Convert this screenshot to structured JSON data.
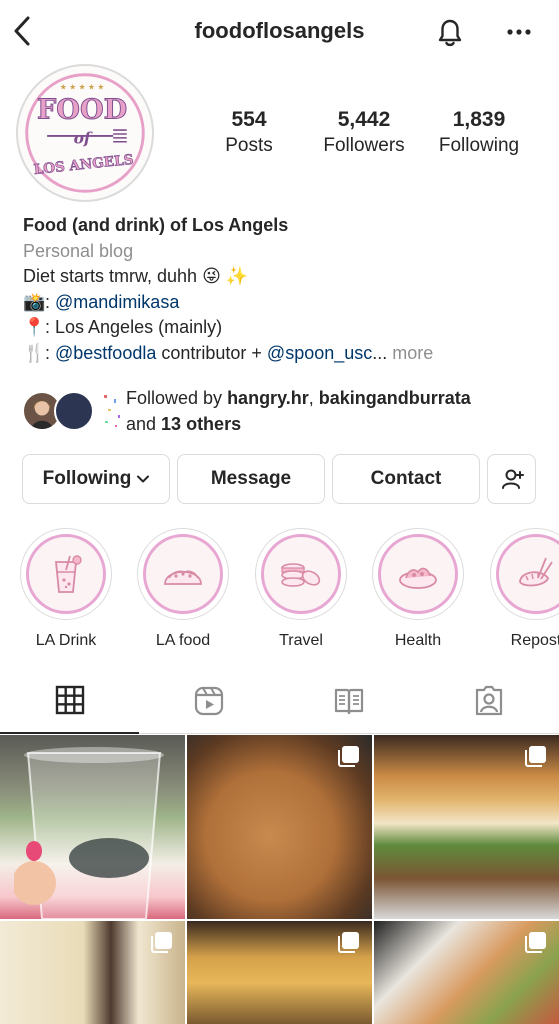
{
  "header": {
    "username": "foodoflosangels",
    "back_icon": "chevron-left-icon",
    "notifications_icon": "bell-icon",
    "more_icon": "more-horizontal-icon"
  },
  "profile": {
    "avatar_logo_lines": [
      "FOOD",
      "of",
      "LOS ANGELS"
    ],
    "stats": {
      "posts_count": "554",
      "posts_label": "Posts",
      "followers_count": "5,442",
      "followers_label": "Followers",
      "following_count": "1,839",
      "following_label": "Following"
    }
  },
  "bio": {
    "display_name": "Food (and drink) of Los Angels",
    "category": "Personal blog",
    "line1": "Diet starts tmrw, duhh",
    "line1_emojis": "😜 ✨",
    "line2_emoji": "📸",
    "line2_prefix": ": ",
    "line2_link": "@mandimikasa",
    "line3_emoji": "📍",
    "line3_text": ": Los Angeles (mainly)",
    "line4_emoji": "🍴",
    "line4_prefix": ": ",
    "line4_link1": "@bestfoodla",
    "line4_mid": " contributor + ",
    "line4_link2": "@spoon_usc",
    "line4_ellipsis": "...",
    "line4_more": "more"
  },
  "followed_by": {
    "prefix": "Followed by ",
    "user1": "hangry.hr",
    "sep": ", ",
    "user2": "bakingandburrata",
    "and": "and ",
    "others": "13 others"
  },
  "actions": {
    "following_label": "Following",
    "message_label": "Message",
    "contact_label": "Contact",
    "add_user_icon": "add-user-icon"
  },
  "highlights": [
    {
      "label": "LA Drink",
      "icon": "drink-icon"
    },
    {
      "label": "LA food",
      "icon": "taco-icon"
    },
    {
      "label": "Travel",
      "icon": "macaron-icon"
    },
    {
      "label": "Health",
      "icon": "salad-icon"
    },
    {
      "label": "Repost",
      "icon": "dumpling-icon"
    }
  ],
  "tabs": [
    {
      "name": "posts",
      "icon": "grid-icon",
      "active": true
    },
    {
      "name": "reels",
      "icon": "reels-icon",
      "active": false
    },
    {
      "name": "guides",
      "icon": "guide-book-icon",
      "active": false
    },
    {
      "name": "tagged",
      "icon": "tagged-user-icon",
      "active": false
    }
  ],
  "colors": {
    "link": "#00376b",
    "muted": "#8e8e8e",
    "highlight_ring": "#e8a7d3",
    "logo_pink": "#e7a1c8",
    "logo_purple": "#7f4e8f"
  }
}
